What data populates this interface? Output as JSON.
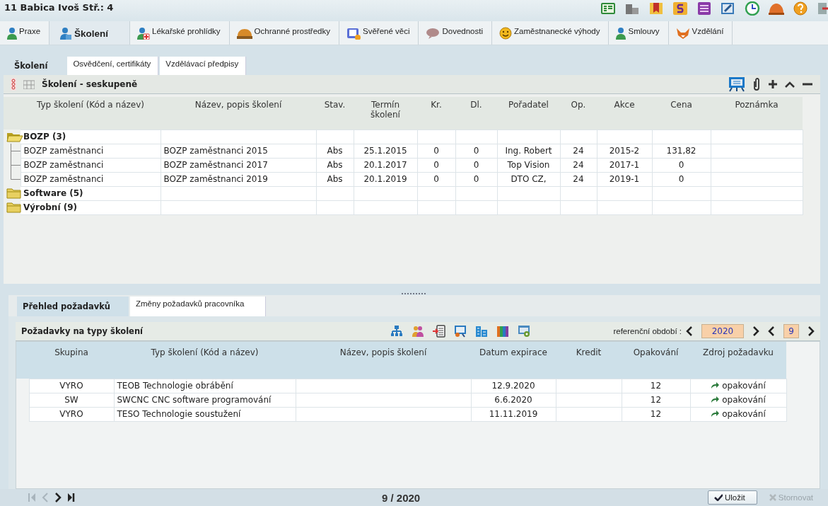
{
  "window": {
    "title": "11 Babica Ivoš Stř.: 4"
  },
  "main_tabs": [
    {
      "label": "Praxe",
      "selected": false
    },
    {
      "label": "Školení",
      "selected": true
    },
    {
      "label": "Lékařské prohlídky",
      "selected": false
    },
    {
      "label": "Ochranné prostředky",
      "selected": false
    },
    {
      "label": "Svěřené věci",
      "selected": false
    },
    {
      "label": "Dovednosti",
      "selected": false
    },
    {
      "label": "Zaměstnanecké výhody",
      "selected": false
    },
    {
      "label": "Smlouvy",
      "selected": false
    },
    {
      "label": "Vzdělání",
      "selected": false
    }
  ],
  "sub_tabs": [
    {
      "label": "Školení",
      "selected": true
    },
    {
      "label": "Osvědčení, certifikáty",
      "selected": false
    },
    {
      "label": "Vzdělávací předpisy",
      "selected": false
    }
  ],
  "training_panel": {
    "title": "Školení - seskupeně",
    "columns": [
      "Typ školení (Kód a název)",
      "Název, popis školení",
      "Stav.",
      "Termín školení",
      "Kr.",
      "Dl.",
      "Pořadatel",
      "Op.",
      "Akce",
      "Cena",
      "Poznámka"
    ],
    "groups": [
      {
        "label": "BOZP (3)",
        "expanded": true,
        "children": [
          {
            "cells": [
              "BOZP zaměstnanci",
              "BOZP zaměstnanci 2015",
              "Abs",
              "25.1.2015",
              "0",
              "0",
              "Ing. Robert",
              "24",
              "2015-2",
              "131,82"
            ]
          },
          {
            "cells": [
              "BOZP zaměstnanci",
              "BOZP zaměstnanci 2017",
              "Abs",
              "20.1.2017",
              "0",
              "0",
              "Top Vision",
              "24",
              "2017-1",
              "0"
            ]
          },
          {
            "cells": [
              "BOZP zaměstnanci",
              "BOZP zaměstnanci 2019",
              "Abs",
              "20.1.2019",
              "0",
              "0",
              "DTO CZ,",
              "24",
              "2019-1",
              "0"
            ]
          }
        ]
      },
      {
        "label": "Software (5)",
        "expanded": false
      },
      {
        "label": "Výrobní (9)",
        "expanded": false
      }
    ]
  },
  "requirement_tabs": [
    {
      "label": "Přehled požadavků",
      "selected": true
    },
    {
      "label": "Změny požadavků pracovníka",
      "selected": false
    }
  ],
  "requirements_panel": {
    "title": "Požadavky na typy školení",
    "period_label": "referenční období :",
    "year": "2020",
    "month": "9",
    "columns": [
      "Skupina",
      "Typ školení (Kód a název)",
      "Název, popis školení",
      "Datum expirace",
      "Kredit",
      "Opakování",
      "Zdroj požadavku"
    ],
    "rows": [
      {
        "cells": [
          "VYRO",
          "TEOB Technologie obrábění",
          "",
          "12.9.2020",
          "",
          "12",
          "opakování"
        ]
      },
      {
        "cells": [
          "SW",
          "SWCNC CNC software programování",
          "",
          "6.6.2020",
          "",
          "12",
          "opakování"
        ]
      },
      {
        "cells": [
          "VYRO",
          "TESO Technologie soustužení",
          "",
          "11.11.2019",
          "",
          "12",
          "opakování"
        ]
      }
    ]
  },
  "footer": {
    "nav_buttons": [
      {
        "kind": "first",
        "disabled": true
      },
      {
        "kind": "prev",
        "disabled": true
      },
      {
        "kind": "next",
        "disabled": false
      },
      {
        "kind": "last",
        "disabled": false
      }
    ],
    "period": "9 / 2020",
    "buttons": [
      {
        "kind": "save",
        "label": "Uložit",
        "disabled": false
      },
      {
        "kind": "cancel",
        "label": "Stornovat",
        "disabled": true
      }
    ]
  }
}
